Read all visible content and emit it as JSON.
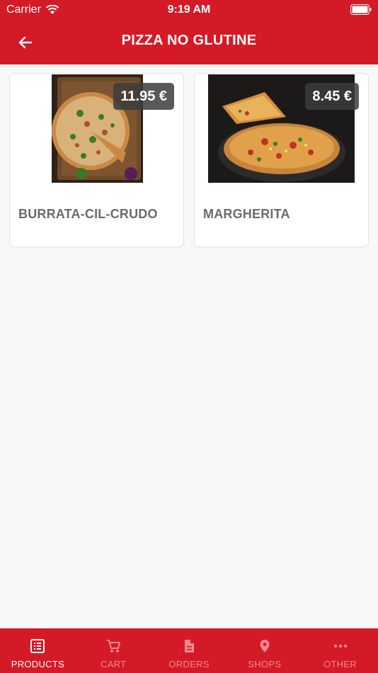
{
  "status": {
    "carrier": "Carrier",
    "time": "9:19 AM"
  },
  "header": {
    "title": "PIZZA NO GLUTINE"
  },
  "products": [
    {
      "name": "BURRATA-CIL-CRUDO",
      "price": "11.95 €"
    },
    {
      "name": "MARGHERITA",
      "price": "8.45 €"
    }
  ],
  "tabs": [
    {
      "label": "PRODUCTS",
      "icon": "list-icon",
      "active": true
    },
    {
      "label": "CART",
      "icon": "cart-icon",
      "active": false
    },
    {
      "label": "ORDERS",
      "icon": "document-icon",
      "active": false
    },
    {
      "label": "SHOPS",
      "icon": "location-pin-icon",
      "active": false
    },
    {
      "label": "OTHER",
      "icon": "more-dots-icon",
      "active": false
    }
  ],
  "colors": {
    "brand": "#d41a26",
    "background": "#f8f8f8",
    "tab_inactive": "#f08a90"
  }
}
